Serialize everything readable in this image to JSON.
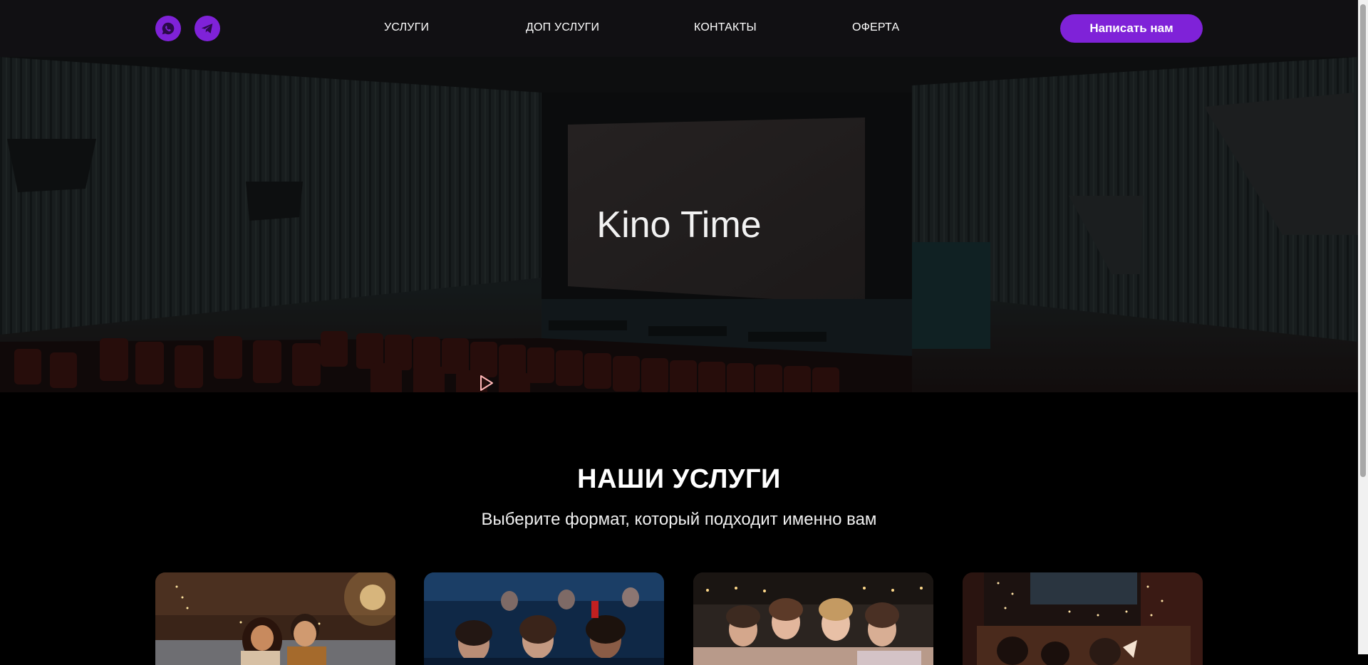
{
  "header": {
    "social": [
      {
        "icon": "whatsapp-icon"
      },
      {
        "icon": "telegram-icon"
      }
    ],
    "nav": [
      {
        "label": "УСЛУГИ"
      },
      {
        "label": "ДОП УСЛУГИ"
      },
      {
        "label": "КОНТАКТЫ"
      },
      {
        "label": "ОФЕРТА"
      }
    ],
    "cta_label": "Написать нам",
    "accent_color": "#7f22d8"
  },
  "hero": {
    "title": "Kino Time",
    "background": "cinema-hall-image"
  },
  "services": {
    "title": "НАШИ УСЛУГИ",
    "subtitle": "Выберите формат, который подходит именно вам",
    "cards": [
      {
        "image": "couple-on-sofa-photo"
      },
      {
        "image": "audience-in-cinema-photo"
      },
      {
        "image": "friends-party-photo"
      },
      {
        "image": "home-cinema-photo"
      }
    ]
  }
}
